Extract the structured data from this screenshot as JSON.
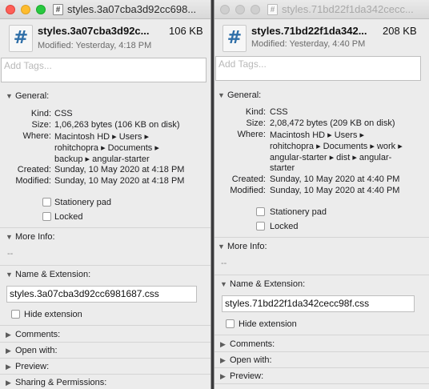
{
  "windows": [
    {
      "titlebar": {
        "title": "styles.3a07cba3d92cc698..."
      },
      "header": {
        "file_icon_glyph": "#",
        "name": "styles.3a07cba3d92c...",
        "size": "106 KB",
        "modified": "Modified: Yesterday, 4:18 PM"
      },
      "tags_placeholder": "Add Tags...",
      "general": {
        "heading": "General:",
        "kind_label": "Kind:",
        "kind": "CSS",
        "size_label": "Size:",
        "size": "1,06,263 bytes (106 KB on disk)",
        "where_label": "Where:",
        "where_lines": [
          "Macintosh HD ▸ Users ▸",
          "rohitchopra ▸ Documents ▸",
          "backup ▸ angular-starter"
        ],
        "created_label": "Created:",
        "created": "Sunday, 10 May 2020 at 4:18 PM",
        "modified_label": "Modified:",
        "modified": "Sunday, 10 May 2020 at 4:18 PM",
        "stationery": "Stationery pad",
        "locked": "Locked"
      },
      "more_info": {
        "heading": "More Info:",
        "value": "--"
      },
      "name_ext": {
        "heading": "Name & Extension:",
        "value": "styles.3a07cba3d92cc6981687.css",
        "hide_ext": "Hide extension"
      },
      "sections": [
        "Comments:",
        "Open with:",
        "Preview:",
        "Sharing & Permissions:"
      ]
    },
    {
      "titlebar": {
        "title": "styles.71bd22f1da342cecc..."
      },
      "header": {
        "file_icon_glyph": "#",
        "name": "styles.71bd22f1da342...",
        "size": "208 KB",
        "modified": "Modified: Yesterday, 4:40 PM"
      },
      "tags_placeholder": "Add Tags...",
      "general": {
        "heading": "General:",
        "kind_label": "Kind:",
        "kind": "CSS",
        "size_label": "Size:",
        "size": "2,08,472 bytes (209 KB on disk)",
        "where_label": "Where:",
        "where_lines": [
          "Macintosh HD ▸ Users ▸",
          "rohitchopra ▸ Documents ▸ work ▸",
          "angular-starter ▸ dist ▸ angular-",
          "starter"
        ],
        "created_label": "Created:",
        "created": "Sunday, 10 May 2020 at 4:40 PM",
        "modified_label": "Modified:",
        "modified": "Sunday, 10 May 2020 at 4:40 PM",
        "stationery": "Stationery pad",
        "locked": "Locked"
      },
      "more_info": {
        "heading": "More Info:",
        "value": "--"
      },
      "name_ext": {
        "heading": "Name & Extension:",
        "value": "styles.71bd22f1da342cecc98f.css",
        "hide_ext": "Hide extension"
      },
      "sections": [
        "Comments:",
        "Open with:",
        "Preview:"
      ]
    }
  ],
  "colors": {
    "close": "#fe5f57",
    "minimize": "#febc2e",
    "zoom": "#28c840",
    "icon_blue": "#2f6fa8"
  },
  "icons": {
    "file": "css-file-icon",
    "disclosure_open": "▼",
    "disclosure_closed": "▶"
  }
}
